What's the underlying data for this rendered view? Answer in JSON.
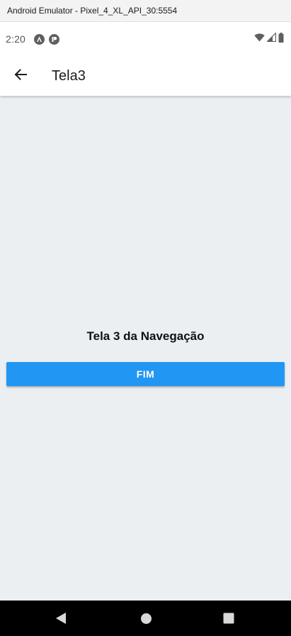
{
  "emulator": {
    "window_title": "Android Emulator - Pixel_4_XL_API_30:5554"
  },
  "status_bar": {
    "time": "2:20",
    "icons": [
      "react-native-icon",
      "app-notification-icon",
      "wifi-icon",
      "cell-signal-icon",
      "battery-icon"
    ]
  },
  "app_bar": {
    "title": "Tela3",
    "back_icon": "arrow-back-icon"
  },
  "screen": {
    "heading": "Tela 3 da Navegação",
    "button_label": "FIM",
    "background": "#ebeff2",
    "button_color": "#2196f3"
  },
  "nav_bar": {
    "icons": [
      "back-triangle-icon",
      "home-circle-icon",
      "recents-square-icon"
    ]
  }
}
